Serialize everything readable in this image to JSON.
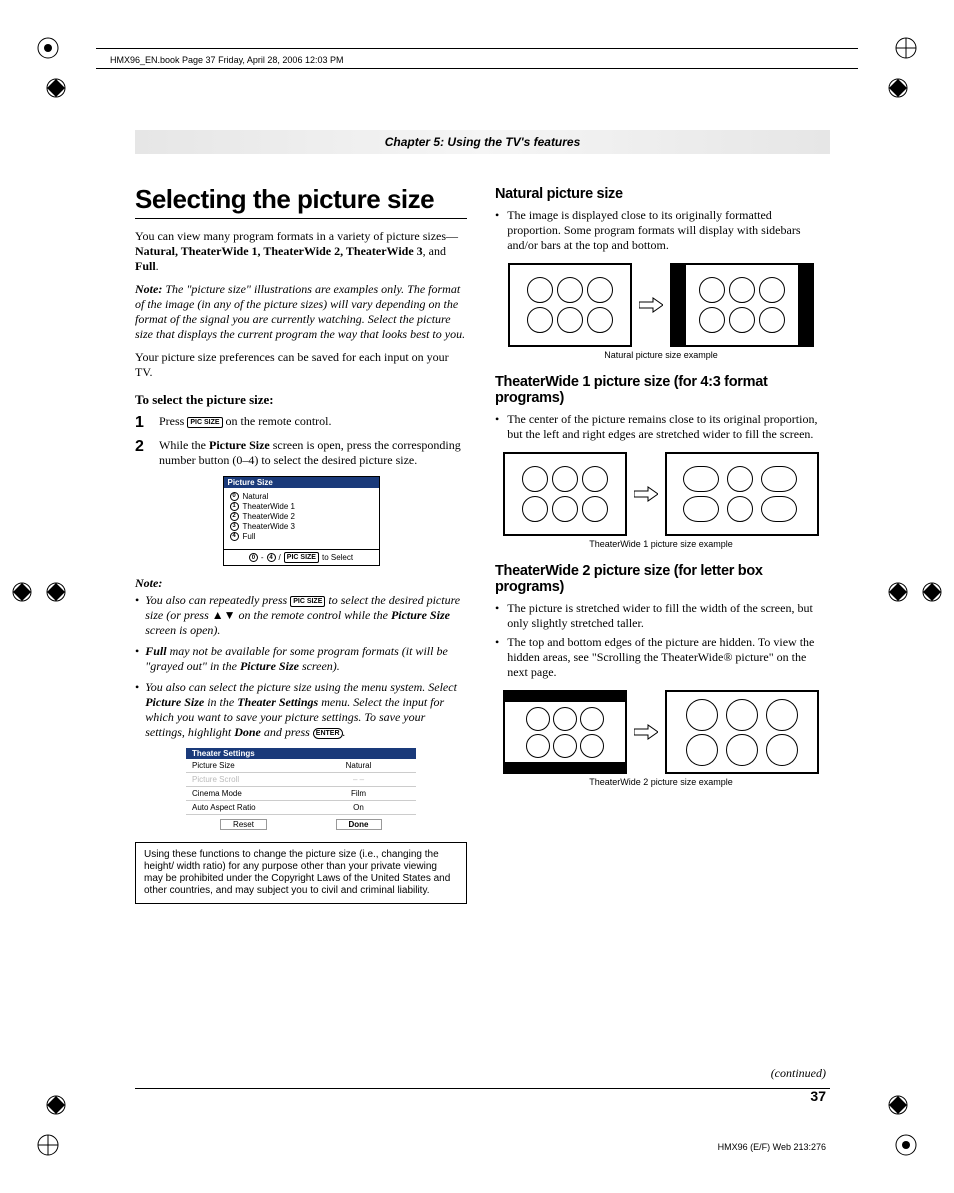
{
  "header_line": "HMX96_EN.book  Page 37  Friday, April 28, 2006  12:03 PM",
  "chapter": "Chapter 5: Using the TV's features",
  "left": {
    "title": "Selecting the picture size",
    "intro_prefix": "You can view many program formats in a variety of picture sizes—",
    "sizes_bold": "Natural, TheaterWide 1, TheaterWide 2, TheaterWide 3",
    "intro_mid": ", and ",
    "sizes_full": "Full",
    "note_label": "Note:",
    "note_text": " The \"picture size\" illustrations are examples only. The format of the image (in any of the picture sizes) will vary depending on the format of the signal you are currently watching. Select the picture size that displays the current program the way that looks best to you.",
    "pref_text": "Your picture size preferences can be saved for each input on your TV.",
    "to_select": "To select the picture size:",
    "step1_a": "Press ",
    "btn_picsize": "PIC SIZE",
    "step1_b": " on the remote control.",
    "step2_a": "While the ",
    "step2_bold": "Picture Size",
    "step2_b": " screen is open, press the corresponding number button (0–4) to select the desired picture size.",
    "menu": {
      "title": "Picture Size",
      "items": [
        "Natural",
        "TheaterWide 1",
        "TheaterWide 2",
        "TheaterWide 3",
        "Full"
      ],
      "foot_nums": [
        "0",
        "4"
      ],
      "foot_sep": " - ",
      "foot_slash": " / ",
      "foot_text": "to Select"
    },
    "note2_label": "Note:",
    "bul1_a": "You also can repeatedly press ",
    "bul1_b": " to select the desired picture size (or press ▲▼ on the remote control while the ",
    "bul1_bold": "Picture Size",
    "bul1_c": " screen is open).",
    "bul2_a": "Full",
    "bul2_b": " may not be available for some program formats (it will be \"grayed out\" in the ",
    "bul2_bold": "Picture Size",
    "bul2_c": " screen).",
    "bul3_a": "You also can select the picture size using the menu system. Select ",
    "bul3_b1": "Picture Size",
    "bul3_b": " in the ",
    "bul3_b2": "Theater Settings",
    "bul3_c": " menu. Select the input for which you want to save your picture settings. To save your settings, highlight ",
    "bul3_b3": "Done",
    "bul3_d": " and press ",
    "btn_enter": "ENTER",
    "settings": {
      "title": "Theater Settings",
      "rows": [
        {
          "label": "Picture Size",
          "value": "Natural"
        },
        {
          "label": "Picture Scroll",
          "value": "– –"
        },
        {
          "label": "Cinema Mode",
          "value": "Film"
        },
        {
          "label": "Auto Aspect Ratio",
          "value": "On"
        }
      ],
      "reset": "Reset",
      "done": "Done"
    },
    "legal": "Using these functions to change the picture size (i.e., changing the height/ width ratio) for any purpose other than your private viewing may be prohibited under the Copyright Laws of the United States and other countries, and may subject you to civil and criminal liability."
  },
  "right": {
    "sec1_title": "Natural picture size",
    "sec1_b1": "The image is displayed close to its originally formatted proportion. Some program formats will display with sidebars and/or bars at the top and bottom.",
    "sec1_caption": "Natural picture size example",
    "sec2_title": "TheaterWide 1 picture size (for 4:3 format programs)",
    "sec2_b1": "The center of the picture remains close to its original proportion, but the left and right edges are stretched wider to fill the screen.",
    "sec2_caption": "TheaterWide 1 picture size example",
    "sec3_title": "TheaterWide 2 picture size (for letter box programs)",
    "sec3_b1": "The picture is stretched wider to fill the width of the screen, but only slightly stretched taller.",
    "sec3_b2": "The top and bottom edges of the picture are hidden. To view the hidden areas, see \"Scrolling the TheaterWide® picture\" on the next page.",
    "sec3_caption": "TheaterWide 2 picture size example"
  },
  "continued": "(continued)",
  "page_number": "37",
  "footer_code": "HMX96 (E/F) Web 213:276"
}
